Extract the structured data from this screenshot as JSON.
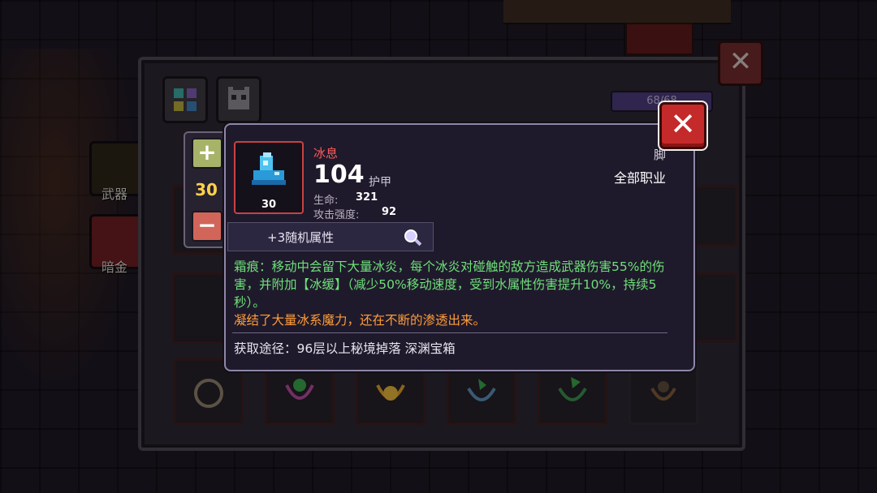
{
  "background": {
    "left_slots": [
      {
        "label": "武器"
      },
      {
        "label": "暗金"
      }
    ],
    "hp_bar": {
      "text": "68/68"
    }
  },
  "level_adjust": {
    "plus_label": "+",
    "minus_label": "−",
    "value": "30"
  },
  "item": {
    "name": "冰息",
    "name_color": "#ff5a5a",
    "level": "30",
    "armor_value": "104",
    "armor_label": "护甲",
    "stats": [
      {
        "label": "生命:",
        "value": "321"
      },
      {
        "label": "攻击强度:",
        "value": "92"
      }
    ],
    "slot_type": "脚",
    "class_requirement": "全部职业",
    "random_attributes": "+3随机属性",
    "effect_text": "霜痕：移动中会留下大量冰炎，每个冰炎对碰触的敌方造成武器伤害55%的伤害，并附加【冰缓】（减少50%移动速度，受到水属性伤害提升10%，持续5秒）。",
    "flavor_text": "凝结了大量冰系魔力，还在不断的渗透出来。",
    "source_text": "获取途径：96层以上秘境掉落 深渊宝箱",
    "icon": "ice-boot-icon"
  },
  "colors": {
    "effect": "#6ee07a",
    "flavor": "#ff9c3a",
    "close_button": "#c42a2a",
    "level_value": "#ffd24a"
  },
  "close_label": "✕"
}
